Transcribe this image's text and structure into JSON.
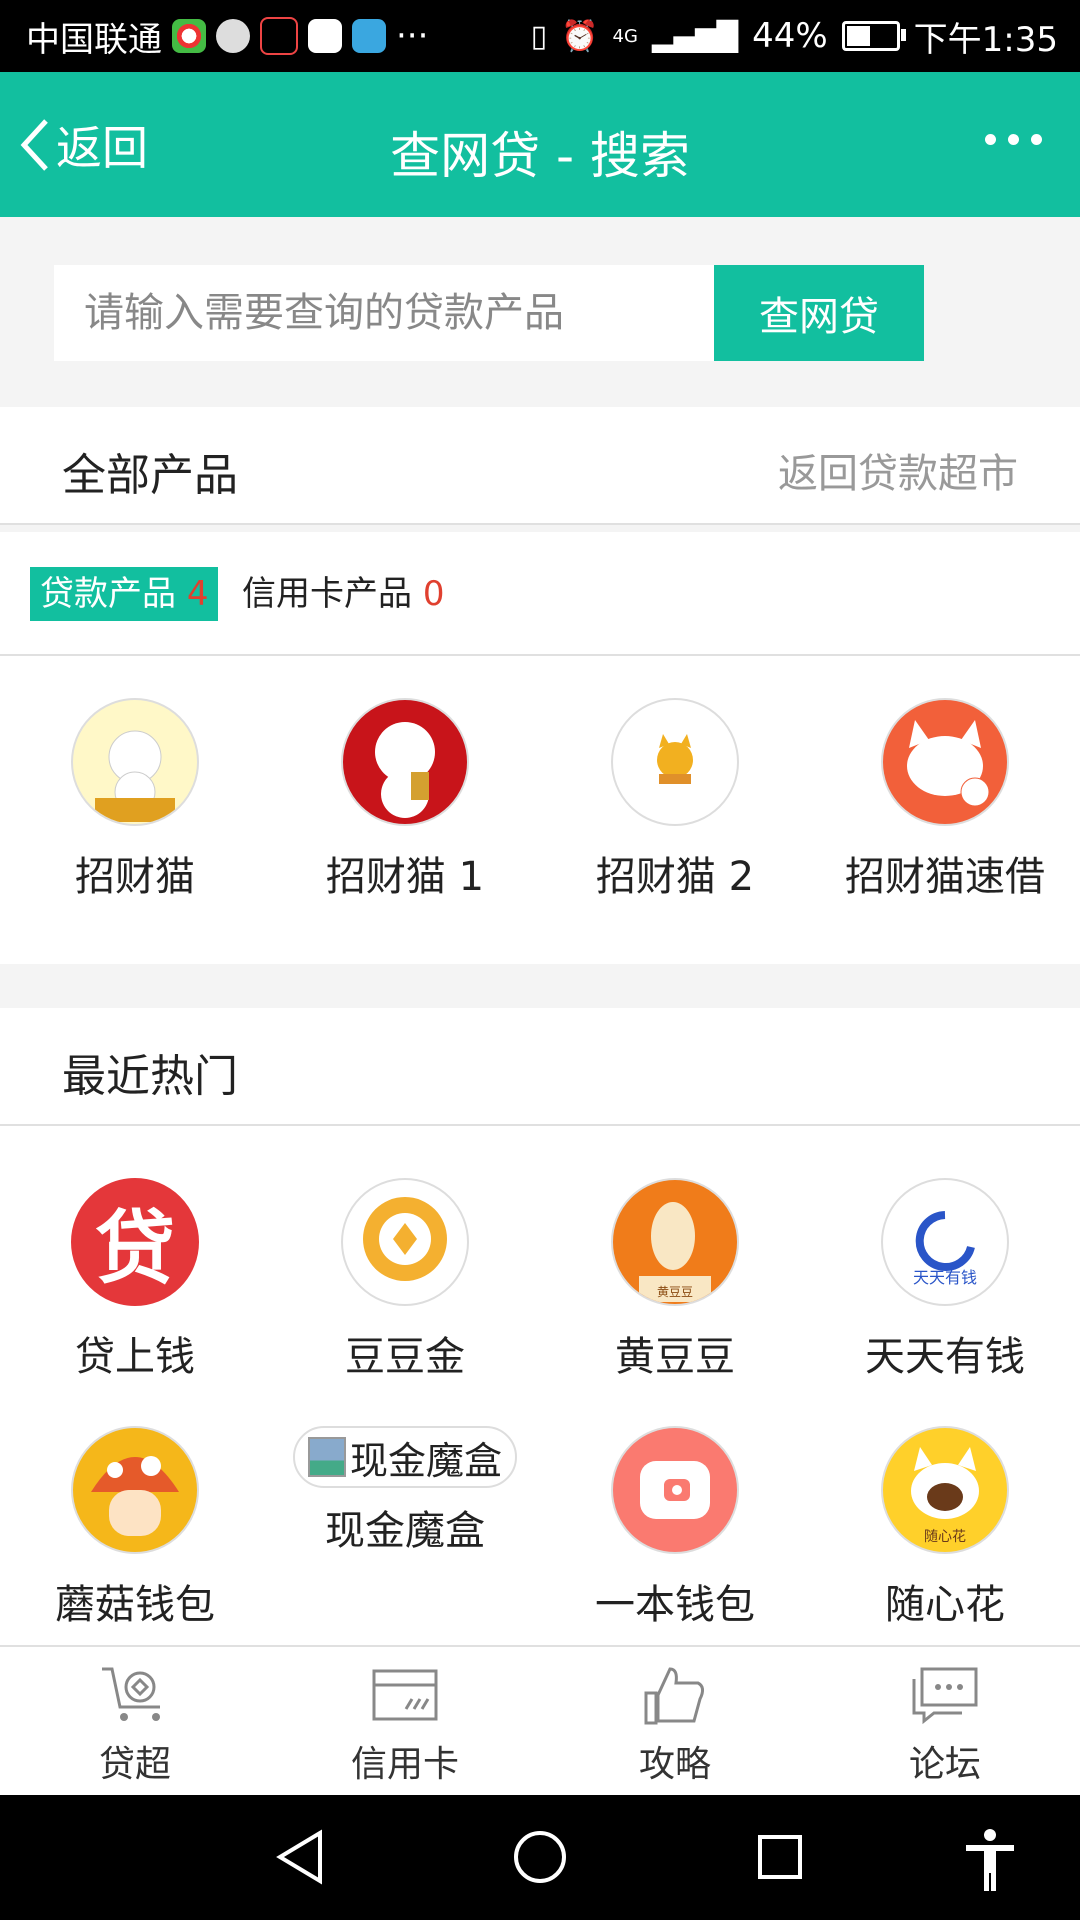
{
  "status_bar": {
    "carrier": "中国联通",
    "dots": "···",
    "network": "4G",
    "battery": "44%",
    "battery_level": 0.44,
    "time": "下午1:35"
  },
  "header": {
    "back_label": "返回",
    "title": "查网贷 - 搜索",
    "accent_color": "#12bf9f"
  },
  "search": {
    "placeholder": "请输入需要查询的贷款产品",
    "button_label": "查网贷"
  },
  "all_products": {
    "title": "全部产品",
    "link": "返回贷款超市",
    "tabs": [
      {
        "label": "贷款产品",
        "count": "4"
      },
      {
        "label": "信用卡产品",
        "count": "0"
      }
    ],
    "items": [
      {
        "label": "招财猫",
        "icon": "lucky-cat-icon"
      },
      {
        "label": "招财猫 1",
        "icon": "lucky-cat-red-icon"
      },
      {
        "label": "招财猫 2",
        "icon": "lucky-cat-small-icon"
      },
      {
        "label": "招财猫速借",
        "icon": "cat-face-icon"
      }
    ]
  },
  "hot": {
    "title": "最近热门",
    "items": [
      {
        "label": "贷上钱",
        "icon": "dai-char-icon",
        "glyph": "贷"
      },
      {
        "label": "豆豆金",
        "icon": "gold-coin-icon"
      },
      {
        "label": "黄豆豆",
        "icon": "bean-mascot-icon",
        "sub": "黄豆豆"
      },
      {
        "label": "天天有钱",
        "icon": "tiantian-icon",
        "sub": "天天有钱"
      },
      {
        "label": "蘑菇钱包",
        "icon": "mushroom-icon"
      },
      {
        "label": "现金魔盒",
        "icon": "broken-image-icon",
        "alt": "现金魔盒"
      },
      {
        "label": "一本钱包",
        "icon": "wallet-icon"
      },
      {
        "label": "随心花",
        "icon": "cat-flower-icon",
        "sub": "随心花"
      }
    ]
  },
  "bottom_nav": [
    {
      "label": "贷超",
      "icon": "cart-icon"
    },
    {
      "label": "信用卡",
      "icon": "credit-card-icon"
    },
    {
      "label": "攻略",
      "icon": "thumbs-up-icon"
    },
    {
      "label": "论坛",
      "icon": "chat-icon"
    }
  ]
}
